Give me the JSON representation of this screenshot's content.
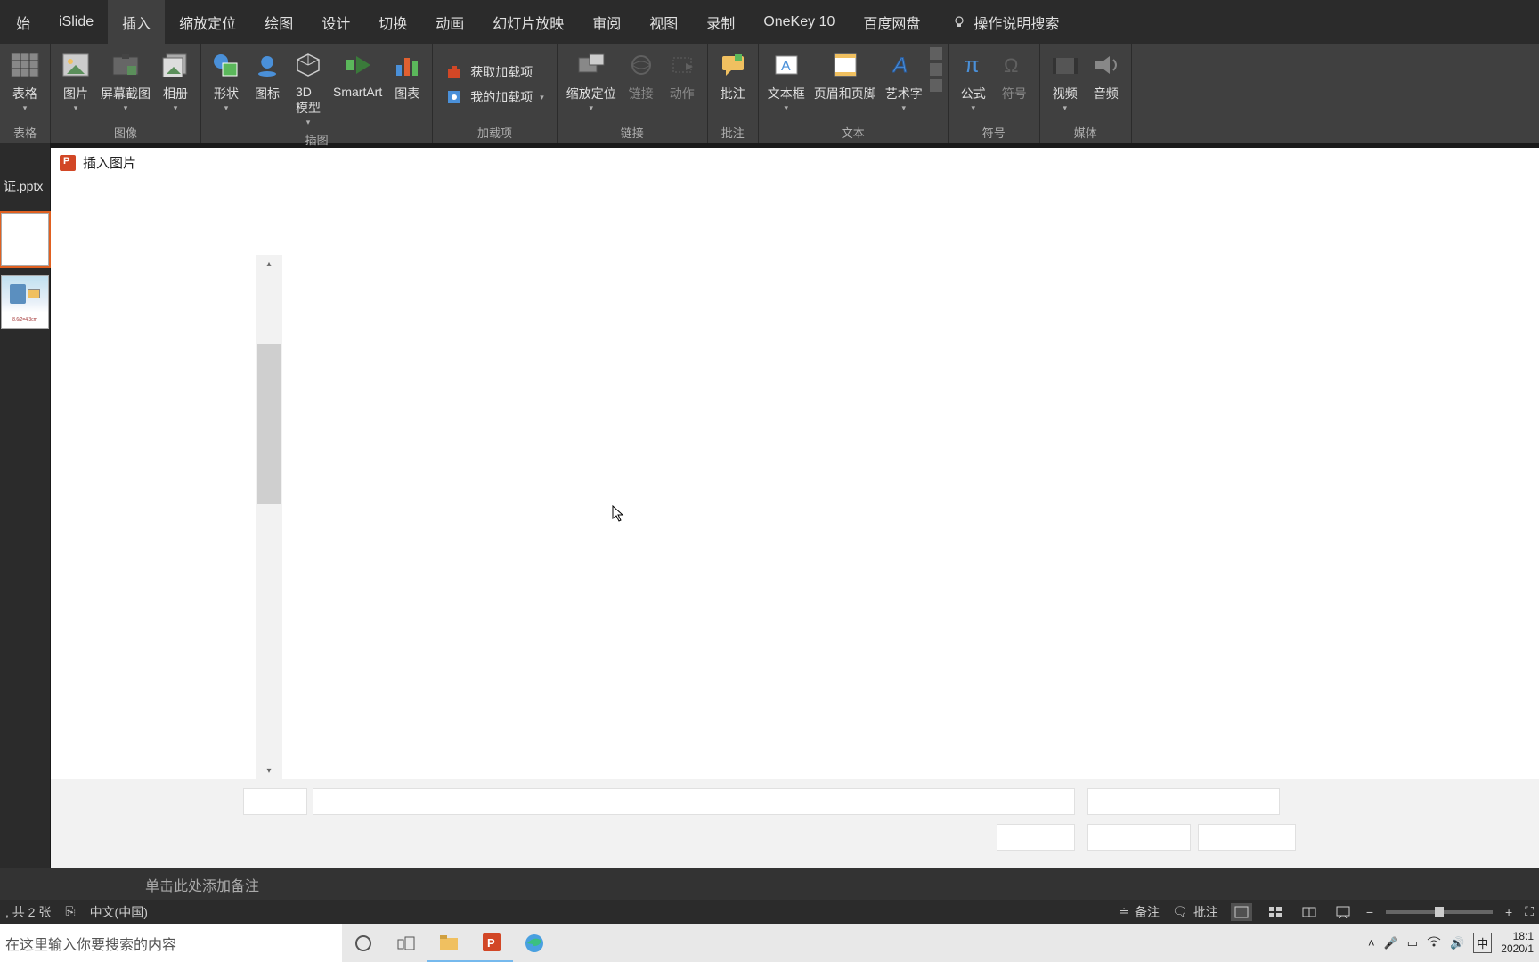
{
  "tabs": {
    "start": "始",
    "islide": "iSlide",
    "insert": "插入",
    "zoom": "缩放定位",
    "draw": "绘图",
    "design": "设计",
    "transition": "切换",
    "animation": "动画",
    "slideshow": "幻灯片放映",
    "review": "审阅",
    "view": "视图",
    "record": "录制",
    "onekey": "OneKey 10",
    "baidu": "百度网盘",
    "help": "操作说明搜索"
  },
  "ribbon": {
    "table": "表格",
    "tables_label": "表格",
    "picture": "图片",
    "screenshot": "屏幕截图",
    "album": "相册",
    "image_label": "图像",
    "shapes": "形状",
    "icons": "图标",
    "model3d": "3D\n模型",
    "smartart": "SmartArt",
    "chart": "图表",
    "illus_label": "插图",
    "getaddin": "获取加载项",
    "myaddin": "我的加载项",
    "addin_label": "加载项",
    "zoomto": "缩放定位",
    "link": "链接",
    "action": "动作",
    "link_label": "链接",
    "comment": "批注",
    "comment_label": "批注",
    "textbox": "文本框",
    "headfoot": "页眉和页脚",
    "wordart": "艺术字",
    "text_label": "文本",
    "equation": "公式",
    "symbol": "符号",
    "symbol_label": "符号",
    "video": "视频",
    "audio": "音频",
    "media_label": "媒体"
  },
  "doc_name": "证.pptx",
  "thumb_txt": "8.6/2=4.3cm",
  "dialog": {
    "title": "插入图片"
  },
  "notes_placeholder": "单击此处添加备注",
  "status": {
    "slides": ", 共 2 张",
    "lang": "中文(中国)",
    "notes": "备注",
    "comments": "批注"
  },
  "taskbar": {
    "search_placeholder": "在这里输入你要搜索的内容",
    "ime": "中",
    "time": "18:1",
    "date": "2020/1"
  }
}
